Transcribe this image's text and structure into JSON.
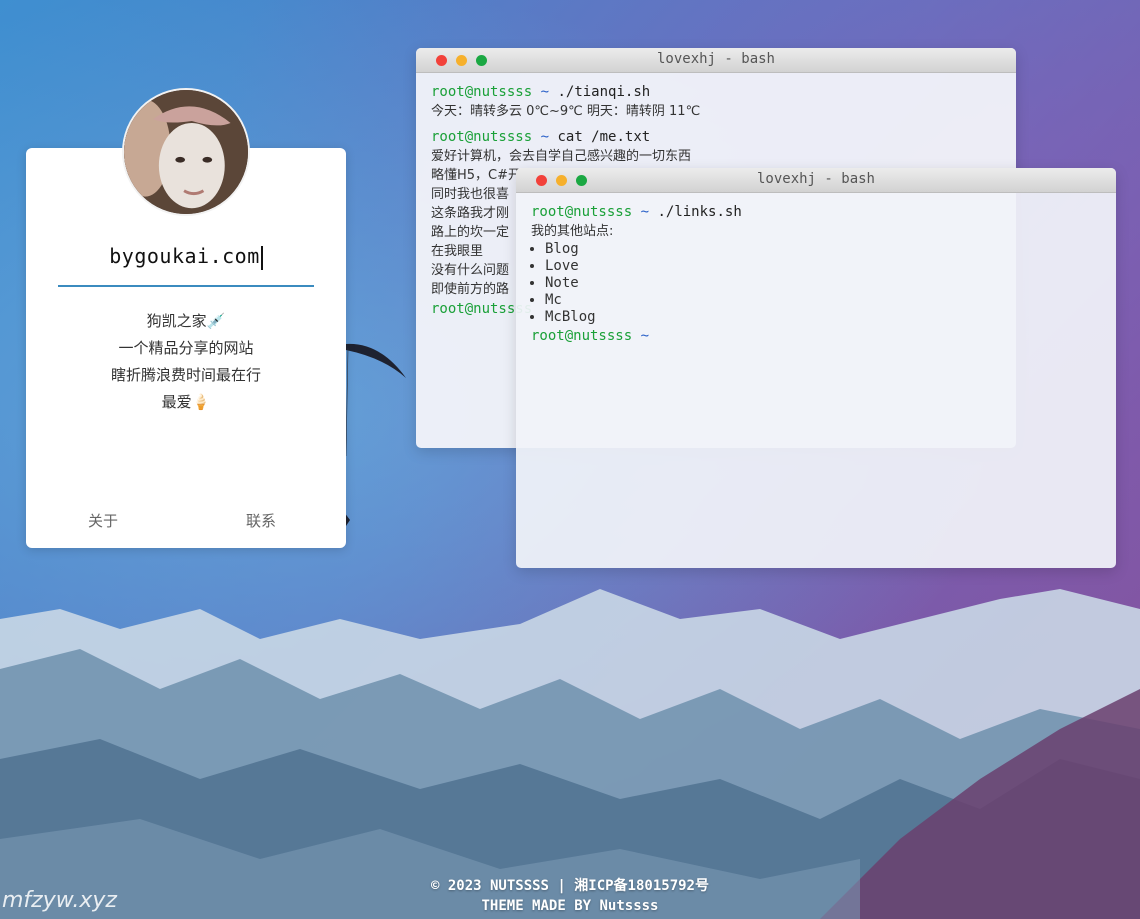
{
  "profile": {
    "site_name": "bygoukai.com",
    "bio": [
      "狗凯之家💉",
      "一个精品分享的网站",
      "瞎折腾浪费时间最在行",
      "最爱🍦"
    ],
    "links": {
      "about": "关于",
      "contact": "联系"
    }
  },
  "terminal_1": {
    "title": "lovexhj - bash",
    "prompt_user": "root@nutssss",
    "prompt_tilde": "~",
    "cmd_1": "./tianqi.sh",
    "weather": "今天：晴转多云 0℃~9℃  明天：晴转阴 11℃",
    "cmd_2": "cat /me.txt",
    "me_lines": [
      "爱好计算机，会去自学自己感兴趣的一切东西",
      "略懂H5，C#开",
      "同时我也很喜",
      "这条路我才刚",
      "路上的坎一定",
      "在我眼里",
      "没有什么问题",
      "即使前方的路"
    ],
    "prompt_3": "root@nutssss"
  },
  "terminal_2": {
    "title": "lovexhj - bash",
    "prompt_user": "root@nutssss",
    "prompt_tilde": "~",
    "cmd": "./links.sh",
    "intro": "我的其他站点:",
    "links": [
      "Blog",
      "Love",
      "Note",
      "Mc",
      "McBlog"
    ]
  },
  "footer": {
    "line1": "© 2023 NUTSSSS | 湘ICP备18015792号",
    "line2": "THEME MADE BY Nutssss"
  },
  "watermark": "mfzyw.xyz",
  "colors": {
    "prompt_user": "#1aa038",
    "prompt_tilde": "#2a60c8",
    "underline": "#3b8bbf",
    "dot_red": "#f2413a",
    "dot_yellow": "#f6b02c",
    "dot_green": "#1ba843"
  }
}
